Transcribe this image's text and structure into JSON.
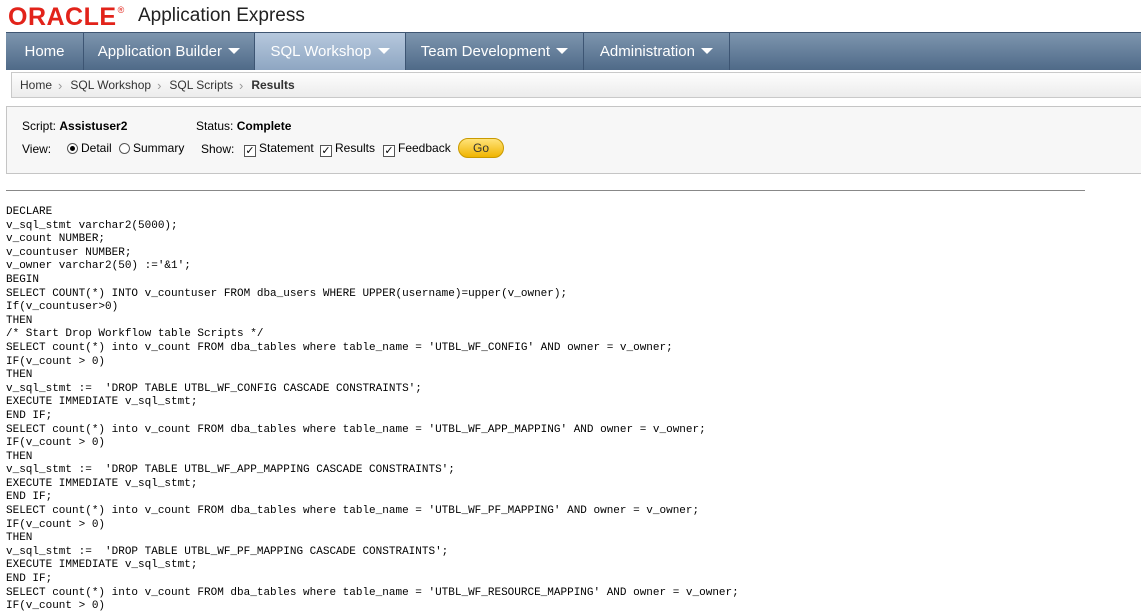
{
  "brand": {
    "logo_text": "ORACLE",
    "logo_mark": "®",
    "product": "Application Express",
    "logo_color": "#e2231a"
  },
  "nav": {
    "tabs": [
      {
        "label": "Home",
        "dropdown": false,
        "active": false
      },
      {
        "label": "Application Builder",
        "dropdown": true,
        "active": false
      },
      {
        "label": "SQL Workshop",
        "dropdown": true,
        "active": true
      },
      {
        "label": "Team Development",
        "dropdown": true,
        "active": false
      },
      {
        "label": "Administration",
        "dropdown": true,
        "active": false
      }
    ]
  },
  "breadcrumb": [
    "Home",
    "SQL Workshop",
    "SQL Scripts",
    "Results"
  ],
  "options": {
    "script_label": "Script:",
    "script_value": "Assistuser2",
    "status_label": "Status:",
    "status_value": "Complete",
    "view_label": "View:",
    "view_detail": "Detail",
    "view_summary": "Summary",
    "view_selected": "Detail",
    "show_label": "Show:",
    "show_statement": "Statement",
    "show_results": "Results",
    "show_feedback": "Feedback",
    "go_label": "Go"
  },
  "code_lines": [
    "DECLARE",
    "v_sql_stmt varchar2(5000);",
    "v_count NUMBER;",
    "v_countuser NUMBER;",
    "v_owner varchar2(50) :='&1';",
    "BEGIN",
    "SELECT COUNT(*) INTO v_countuser FROM dba_users WHERE UPPER(username)=upper(v_owner);",
    "If(v_countuser>0)",
    "THEN",
    "/* Start Drop Workflow table Scripts */",
    "SELECT count(*) into v_count FROM dba_tables where table_name = 'UTBL_WF_CONFIG' AND owner = v_owner;",
    "IF(v_count > 0)",
    "THEN",
    "v_sql_stmt :=  'DROP TABLE UTBL_WF_CONFIG CASCADE CONSTRAINTS';",
    "EXECUTE IMMEDIATE v_sql_stmt;",
    "END IF;",
    "SELECT count(*) into v_count FROM dba_tables where table_name = 'UTBL_WF_APP_MAPPING' AND owner = v_owner;",
    "IF(v_count > 0)",
    "THEN",
    "v_sql_stmt :=  'DROP TABLE UTBL_WF_APP_MAPPING CASCADE CONSTRAINTS';",
    "EXECUTE IMMEDIATE v_sql_stmt;",
    "END IF;",
    "SELECT count(*) into v_count FROM dba_tables where table_name = 'UTBL_WF_PF_MAPPING' AND owner = v_owner;",
    "IF(v_count > 0)",
    "THEN",
    "v_sql_stmt :=  'DROP TABLE UTBL_WF_PF_MAPPING CASCADE CONSTRAINTS';",
    "EXECUTE IMMEDIATE v_sql_stmt;",
    "END IF;",
    "SELECT count(*) into v_count FROM dba_tables where table_name = 'UTBL_WF_RESOURCE_MAPPING' AND owner = v_owner;",
    "IF(v_count > 0)"
  ]
}
